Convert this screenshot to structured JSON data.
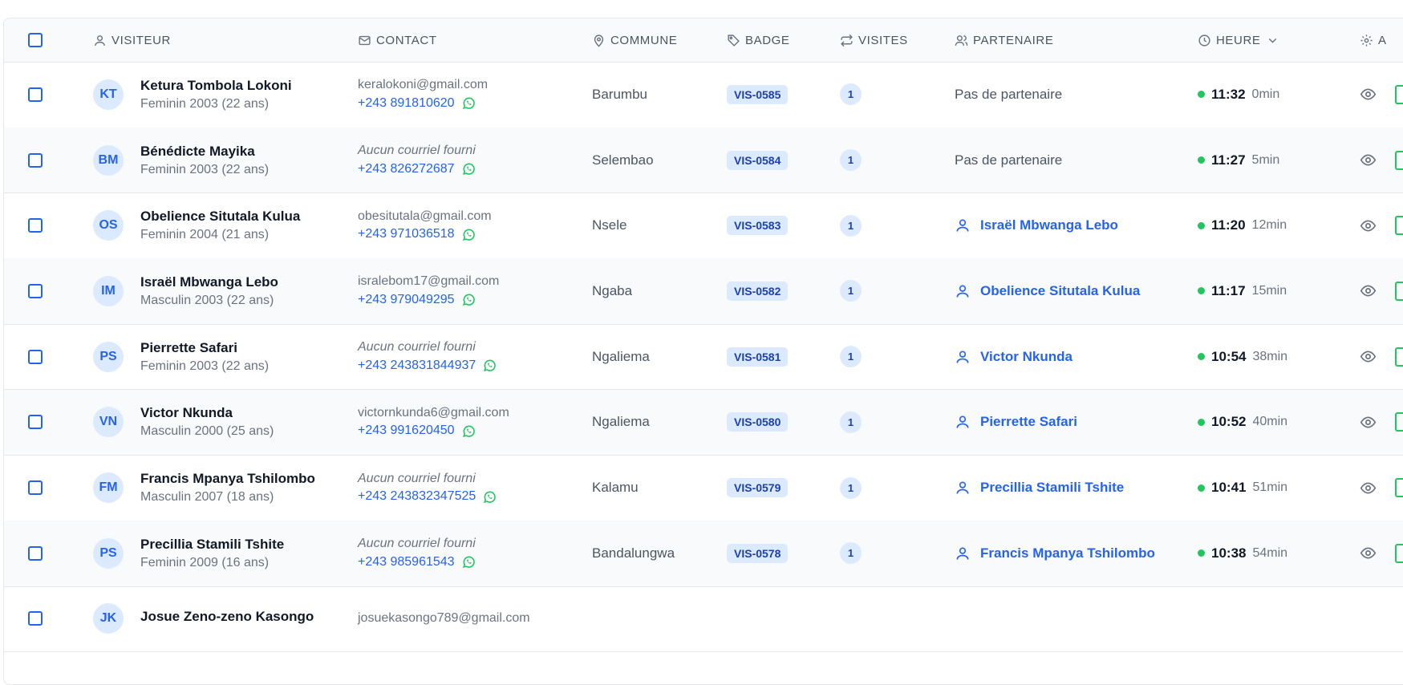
{
  "columns": {
    "visitor": "VISITEUR",
    "contact": "CONTACT",
    "commune": "COMMUNE",
    "badge": "BADGE",
    "visits": "VISITES",
    "partner": "PARTENAIRE",
    "time": "HEURE",
    "actions": "A"
  },
  "colors": {
    "accent": "#2563eb",
    "badge_bg": "#dbeafe",
    "online": "#22c55e",
    "whatsapp": "#22c55e"
  },
  "rows": [
    {
      "initials": "KT",
      "name": "Ketura Tombola Lokoni",
      "info": "Feminin 2003 (22 ans)",
      "email": "keralokoni@gmail.com",
      "email_missing": false,
      "phone": "+243 891810620",
      "commune": "Barumbu",
      "badge": "VIS-0585",
      "visits": "1",
      "partner": "Pas de partenaire",
      "has_partner": false,
      "time": "11:32",
      "ago": "0min"
    },
    {
      "initials": "BM",
      "name": "Bénédicte Mayika",
      "info": "Feminin 2003 (22 ans)",
      "email": "Aucun courriel fourni",
      "email_missing": true,
      "phone": "+243 826272687",
      "commune": "Selembao",
      "badge": "VIS-0584",
      "visits": "1",
      "partner": "Pas de partenaire",
      "has_partner": false,
      "time": "11:27",
      "ago": "5min"
    },
    {
      "initials": "OS",
      "name": "Obelience Situtala Kulua",
      "info": "Feminin 2004 (21 ans)",
      "email": "obesitutala@gmail.com",
      "email_missing": false,
      "phone": "+243 971036518",
      "commune": "Nsele",
      "badge": "VIS-0583",
      "visits": "1",
      "partner": "Israël Mbwanga Lebo",
      "has_partner": true,
      "time": "11:20",
      "ago": "12min"
    },
    {
      "initials": "IM",
      "name": "Israël Mbwanga Lebo",
      "info": "Masculin 2003 (22 ans)",
      "email": "isralebom17@gmail.com",
      "email_missing": false,
      "phone": "+243 979049295",
      "commune": "Ngaba",
      "badge": "VIS-0582",
      "visits": "1",
      "partner": "Obelience Situtala Kulua",
      "has_partner": true,
      "time": "11:17",
      "ago": "15min"
    },
    {
      "initials": "PS",
      "name": "Pierrette Safari",
      "info": "Feminin 2003 (22 ans)",
      "email": "Aucun courriel fourni",
      "email_missing": true,
      "phone": "+243 243831844937",
      "commune": "Ngaliema",
      "badge": "VIS-0581",
      "visits": "1",
      "partner": "Victor Nkunda",
      "has_partner": true,
      "time": "10:54",
      "ago": "38min"
    },
    {
      "initials": "VN",
      "name": "Victor Nkunda",
      "info": "Masculin 2000 (25 ans)",
      "email": "victornkunda6@gmail.com",
      "email_missing": false,
      "phone": "+243 991620450",
      "commune": "Ngaliema",
      "badge": "VIS-0580",
      "visits": "1",
      "partner": "Pierrette Safari",
      "has_partner": true,
      "time": "10:52",
      "ago": "40min"
    },
    {
      "initials": "FM",
      "name": "Francis Mpanya Tshilombo",
      "info": "Masculin 2007 (18 ans)",
      "email": "Aucun courriel fourni",
      "email_missing": true,
      "phone": "+243 243832347525",
      "commune": "Kalamu",
      "badge": "VIS-0579",
      "visits": "1",
      "partner": "Precillia Stamili Tshite",
      "has_partner": true,
      "time": "10:41",
      "ago": "51min"
    },
    {
      "initials": "PS",
      "name": "Precillia Stamili Tshite",
      "info": "Feminin 2009 (16 ans)",
      "email": "Aucun courriel fourni",
      "email_missing": true,
      "phone": "+243 985961543",
      "commune": "Bandalungwa",
      "badge": "VIS-0578",
      "visits": "1",
      "partner": "Francis Mpanya Tshilombo",
      "has_partner": true,
      "time": "10:38",
      "ago": "54min"
    },
    {
      "initials": "JK",
      "name": "Josue Zeno-zeno Kasongo",
      "info": "",
      "email": "josuekasongo789@gmail.com",
      "email_missing": false,
      "phone": "",
      "commune": "",
      "badge": "",
      "visits": "",
      "partner": "",
      "has_partner": false,
      "time": "",
      "ago": ""
    }
  ]
}
